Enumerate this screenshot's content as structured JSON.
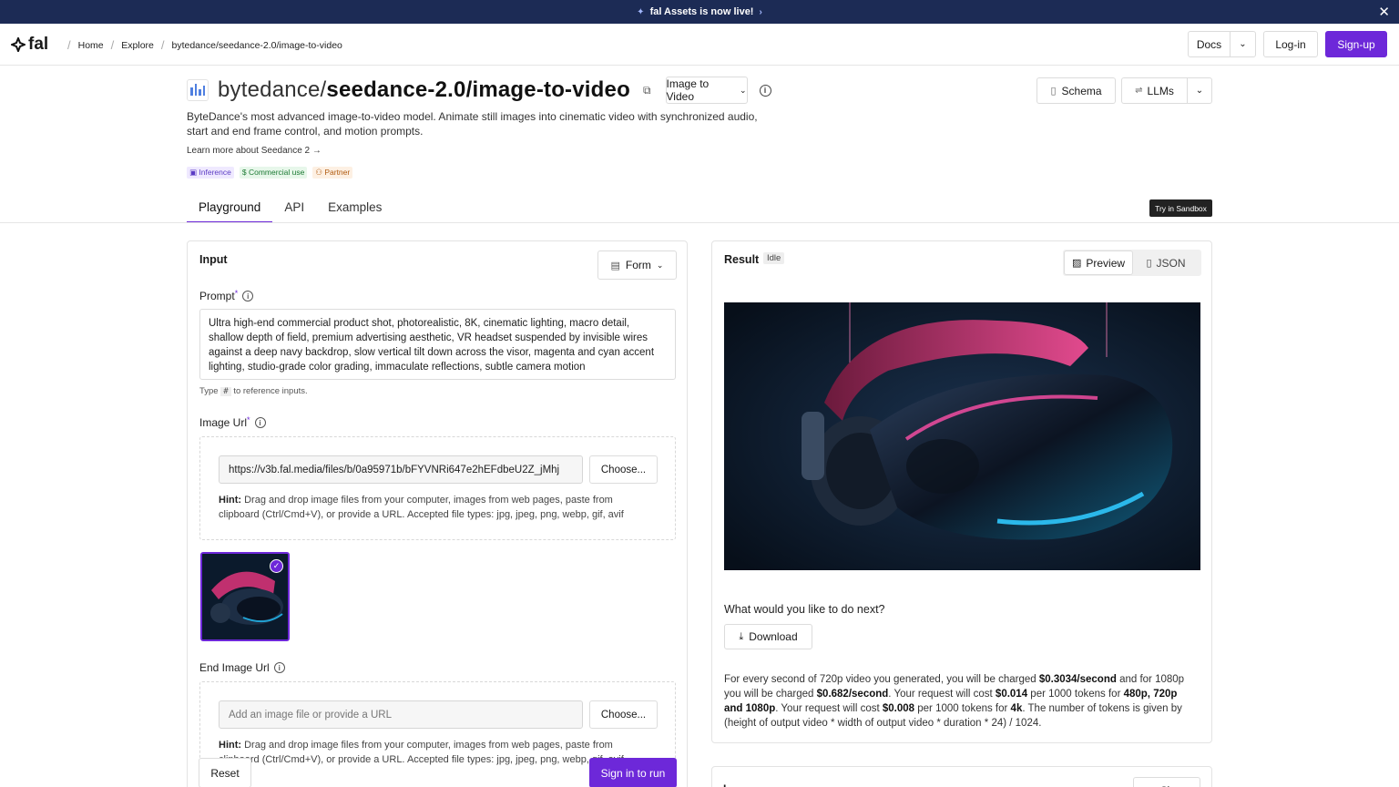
{
  "banner": {
    "text": "fal Assets is now live!",
    "close": "✕"
  },
  "nav": {
    "logo": "fal",
    "breadcrumbs": [
      "Home",
      "Explore",
      "bytedance/seedance-2.0/image-to-video"
    ],
    "docs": "Docs",
    "login": "Log-in",
    "signup": "Sign-up"
  },
  "model": {
    "owner": "bytedance/",
    "name": "seedance-2.0/image-to-video",
    "category": "Image to Video",
    "schema": "Schema",
    "llms": "LLMs",
    "description": "ByteDance's most advanced image-to-video model. Animate still images into cinematic video with synchronized audio, start and end frame control, and motion prompts.",
    "learn_more": "Learn more about Seedance 2 →",
    "tags": [
      "Inference",
      "Commercial use",
      "Partner"
    ]
  },
  "tabs": [
    "Playground",
    "API",
    "Examples"
  ],
  "sandbox": "Try in Sandbox",
  "input": {
    "title": "Input",
    "form": "Form",
    "prompt_label": "Prompt",
    "prompt_value": "Ultra high-end commercial product shot, photorealistic, 8K, cinematic lighting, macro detail, shallow depth of field, premium advertising aesthetic, VR headset suspended by invisible wires against a deep navy backdrop, slow vertical tilt down across the visor, magenta and cyan accent lighting, studio-grade color grading, immaculate reflections, subtle camera motion",
    "type_hint_pre": "Type",
    "type_hint_key": "#",
    "type_hint_post": "to reference inputs.",
    "image_url_label": "Image Url",
    "image_url_value": "https://v3b.fal.media/files/b/0a95971b/bFYVNRi647e2hEFdbeU2Z_jMhj",
    "choose": "Choose...",
    "hint_label": "Hint:",
    "hint_text": "Drag and drop image files from your computer, images from web pages, paste from clipboard (Ctrl/Cmd+V), or provide a URL. Accepted file types: jpg, jpeg, png, webp, gif, avif",
    "end_image_label": "End Image Url",
    "end_image_placeholder": "Add an image file or provide a URL",
    "reset": "Reset",
    "run": "Sign in to run"
  },
  "result": {
    "title": "Result",
    "status": "Idle",
    "preview": "Preview",
    "json": "JSON",
    "next_question": "What would you like to do next?",
    "download": "Download",
    "pricing": {
      "p1": "For every second of 720p video you generated, you will be charged ",
      "v1": "$0.3034/second",
      "p2": " and for 1080p you will be charged ",
      "v2": "$0.682/second",
      "p3": ". Your request will cost ",
      "v3": "$0.014",
      "p4": " per 1000 tokens for ",
      "v4": "480p, 720p and 1080p",
      "p5": ". Your request will cost ",
      "v5": "$0.008",
      "p6": " per 1000 tokens for ",
      "v6": "4k",
      "p7": ". The number of tokens is given by (height of output video * width of output video * duration * 24) / 1024."
    }
  },
  "next_panel": {
    "title": "L",
    "button": "Sh"
  },
  "colors": {
    "accent": "#6d28d9",
    "banner": "#1c2b55"
  }
}
